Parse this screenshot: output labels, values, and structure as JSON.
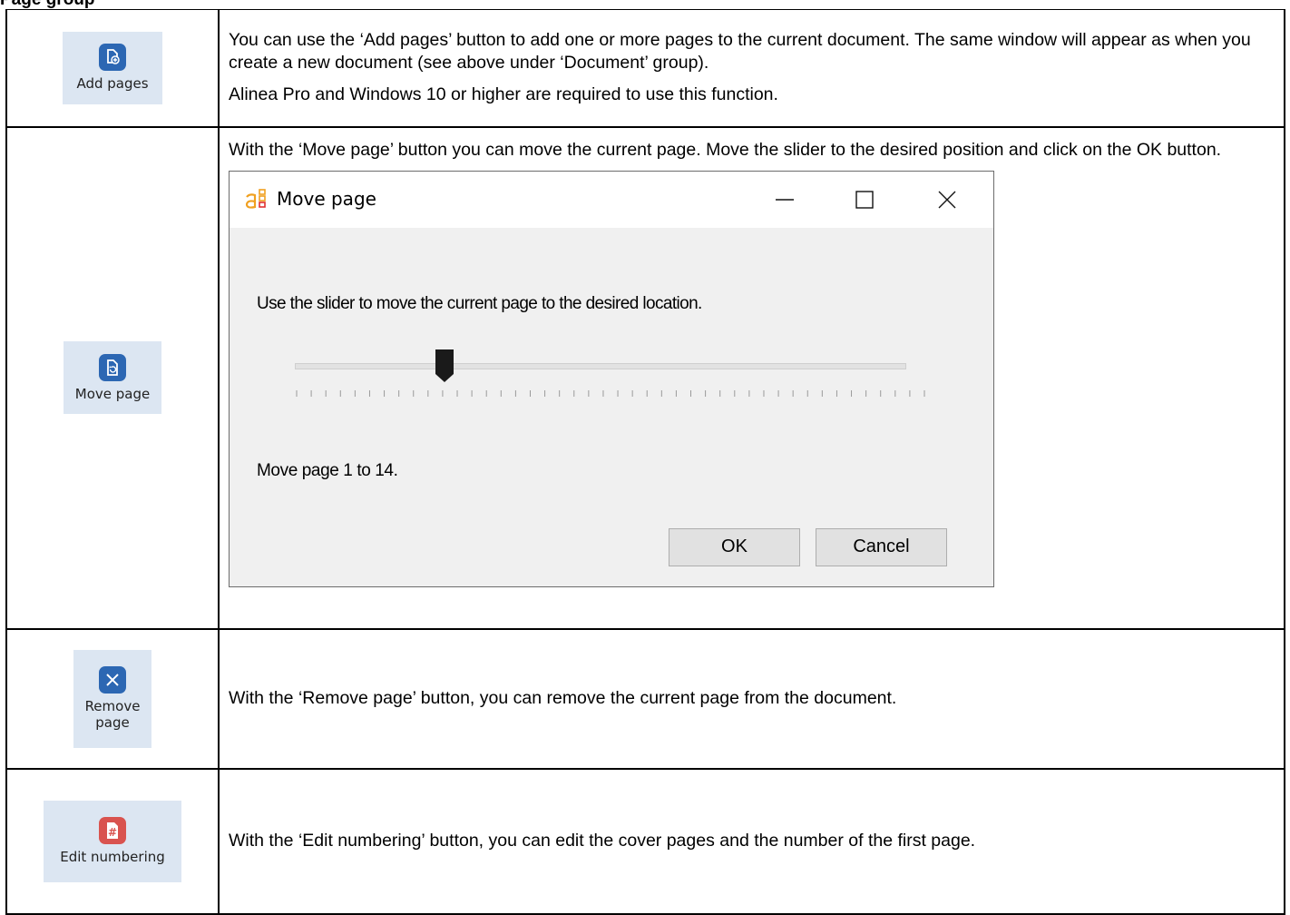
{
  "heading": "Page group",
  "rows": {
    "add_pages": {
      "button_label": "Add pages",
      "text1": "You can use the ‘Add pages’ button to add one or more pages to the current document. The same window will appear as when you create a new document (see above under ‘Document’ group).",
      "text2": "Alinea Pro and Windows 10 or higher are required to use this function."
    },
    "move_page": {
      "button_label": "Move page",
      "text": "With the ‘Move page’ button you can move the current page. Move the slider to the desired position and click on the OK button."
    },
    "remove_page": {
      "button_label_line1": "Remove",
      "button_label_line2": "page",
      "text": "With the ‘Remove page’ button, you can remove the current page from the document."
    },
    "edit_numbering": {
      "button_label": "Edit numbering",
      "text": "With the ‘Edit numbering’ button, you can edit the cover pages and the number of the first page."
    }
  },
  "dialog": {
    "title": "Move page",
    "prompt": "Use the slider to move the current page to the desired location.",
    "slider_position": 0.24,
    "status": "Move page 1 to 14.",
    "ok_label": "OK",
    "cancel_label": "Cancel"
  },
  "colors": {
    "icon_blue": "#2c67b3",
    "icon_red": "#d9534f",
    "button_bg": "#dce6f2"
  }
}
